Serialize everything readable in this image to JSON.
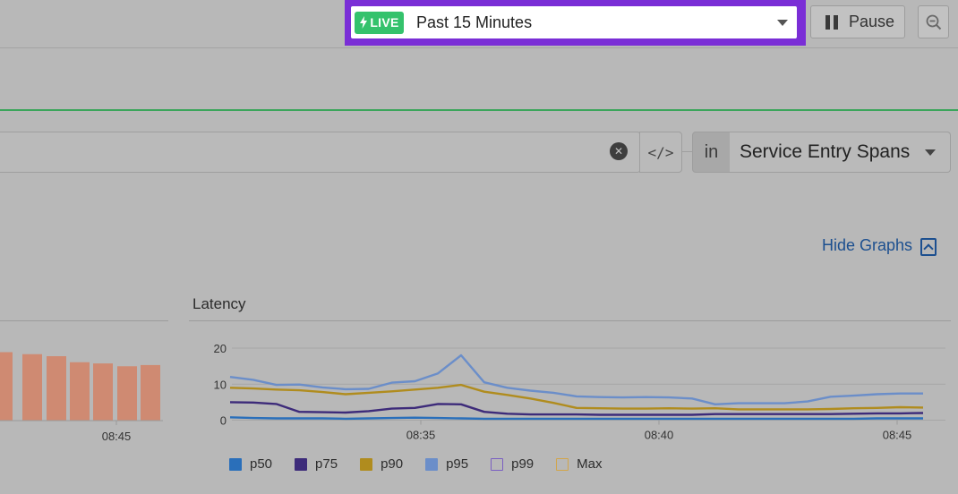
{
  "time_picker": {
    "live_label": "LIVE",
    "range": "Past 15 Minutes"
  },
  "pause_label": "Pause",
  "query": {
    "scope_prefix": "in",
    "scope_value": "Service Entry Spans"
  },
  "hide_graphs_label": "Hide Graphs",
  "colors": {
    "live_badge": "#34c26c",
    "highlight_border": "#7a2ed6",
    "link": "#1c4f8f",
    "bar_fill": "#cf8a72"
  },
  "left_chart": {
    "chart_data": {
      "type": "bar",
      "x_tick_labels": [
        "08:45"
      ],
      "values": [
        17,
        16.5,
        16,
        14.5,
        14.2,
        13.5,
        13.8
      ],
      "ylim": [
        0,
        20
      ]
    }
  },
  "latency": {
    "title": "Latency",
    "chart_data": {
      "type": "line",
      "title": "Latency",
      "y_ticks": [
        0,
        10,
        20
      ],
      "ylim": [
        0,
        22
      ],
      "x_tick_labels": [
        "08:35",
        "08:40",
        "08:45"
      ],
      "series": [
        {
          "name": "p50",
          "color": "#2a6fba",
          "values": [
            0.8,
            0.6,
            0.5,
            0.5,
            0.5,
            0.4,
            0.5,
            0.6,
            0.7,
            0.6,
            0.5,
            0.4,
            0.4,
            0.4,
            0.4,
            0.4,
            0.4,
            0.4,
            0.4,
            0.4,
            0.4,
            0.4,
            0.4,
            0.4,
            0.4,
            0.4,
            0.4,
            0.4,
            0.5,
            0.5,
            0.5
          ]
        },
        {
          "name": "p75",
          "color": "#3d2b7a",
          "values": [
            5.0,
            4.9,
            4.5,
            2.3,
            2.2,
            2.1,
            2.5,
            3.2,
            3.4,
            4.5,
            4.4,
            2.3,
            1.8,
            1.6,
            1.6,
            1.6,
            1.5,
            1.5,
            1.5,
            1.5,
            1.5,
            1.7,
            1.7,
            1.7,
            1.7,
            1.7,
            1.7,
            1.8,
            1.9,
            1.9,
            2.0
          ]
        },
        {
          "name": "p90",
          "color": "#b08c1e",
          "values": [
            9.0,
            8.8,
            8.5,
            8.3,
            7.8,
            7.2,
            7.6,
            8.0,
            8.5,
            9.0,
            9.8,
            7.9,
            7.0,
            6.0,
            4.8,
            3.4,
            3.3,
            3.2,
            3.2,
            3.3,
            3.2,
            3.3,
            3.0,
            3.0,
            3.0,
            3.0,
            3.1,
            3.3,
            3.4,
            3.6,
            3.5
          ]
        },
        {
          "name": "p95",
          "color": "#6b8ec9",
          "values": [
            12.0,
            11.2,
            9.8,
            9.9,
            9.1,
            8.6,
            8.7,
            10.4,
            10.8,
            13.0,
            18.0,
            10.5,
            9.0,
            8.2,
            7.6,
            6.6,
            6.4,
            6.3,
            6.4,
            6.3,
            6.0,
            4.4,
            4.7,
            4.7,
            4.7,
            5.2,
            6.5,
            6.8,
            7.2,
            7.4,
            7.4
          ]
        },
        {
          "name": "p99",
          "color": "#7a5fc2",
          "values": []
        },
        {
          "name": "Max",
          "color": "#d2a54a",
          "values": []
        }
      ]
    }
  },
  "legend": [
    {
      "label": "p50",
      "color": "#2a6fba",
      "filled": true
    },
    {
      "label": "p75",
      "color": "#3d2b7a",
      "filled": true
    },
    {
      "label": "p90",
      "color": "#b08c1e",
      "filled": true
    },
    {
      "label": "p95",
      "color": "#6b8ec9",
      "filled": true
    },
    {
      "label": "p99",
      "color": "#7a5fc2",
      "filled": false
    },
    {
      "label": "Max",
      "color": "#d2a54a",
      "filled": false
    }
  ]
}
